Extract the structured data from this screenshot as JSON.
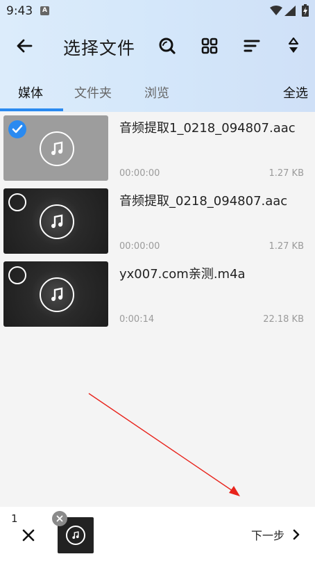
{
  "status_bar": {
    "time": "9:43",
    "notification_icon": "A"
  },
  "toolbar": {
    "title": "选择文件",
    "icons": [
      "back-arrow-icon",
      "search-icon",
      "grid-view-icon",
      "sort-icon",
      "filter-icon"
    ]
  },
  "tabs": {
    "items": [
      {
        "label": "媒体",
        "active": true
      },
      {
        "label": "文件夹",
        "active": false
      },
      {
        "label": "浏览",
        "active": false
      }
    ],
    "select_all": "全选",
    "accent": "#2a8af0"
  },
  "files": [
    {
      "name": "音频提取1_0218_094807.aac",
      "duration": "00:00:00",
      "size": "1.27 KB",
      "selected": true
    },
    {
      "name": "音频提取_0218_094807.aac",
      "duration": "00:00:00",
      "size": "1.27 KB",
      "selected": false
    },
    {
      "name": "yx007.com亲测.m4a",
      "duration": "0:00:14",
      "size": "22.18 KB",
      "selected": false
    }
  ],
  "bottom_bar": {
    "count": "1",
    "next_label": "下一步"
  }
}
